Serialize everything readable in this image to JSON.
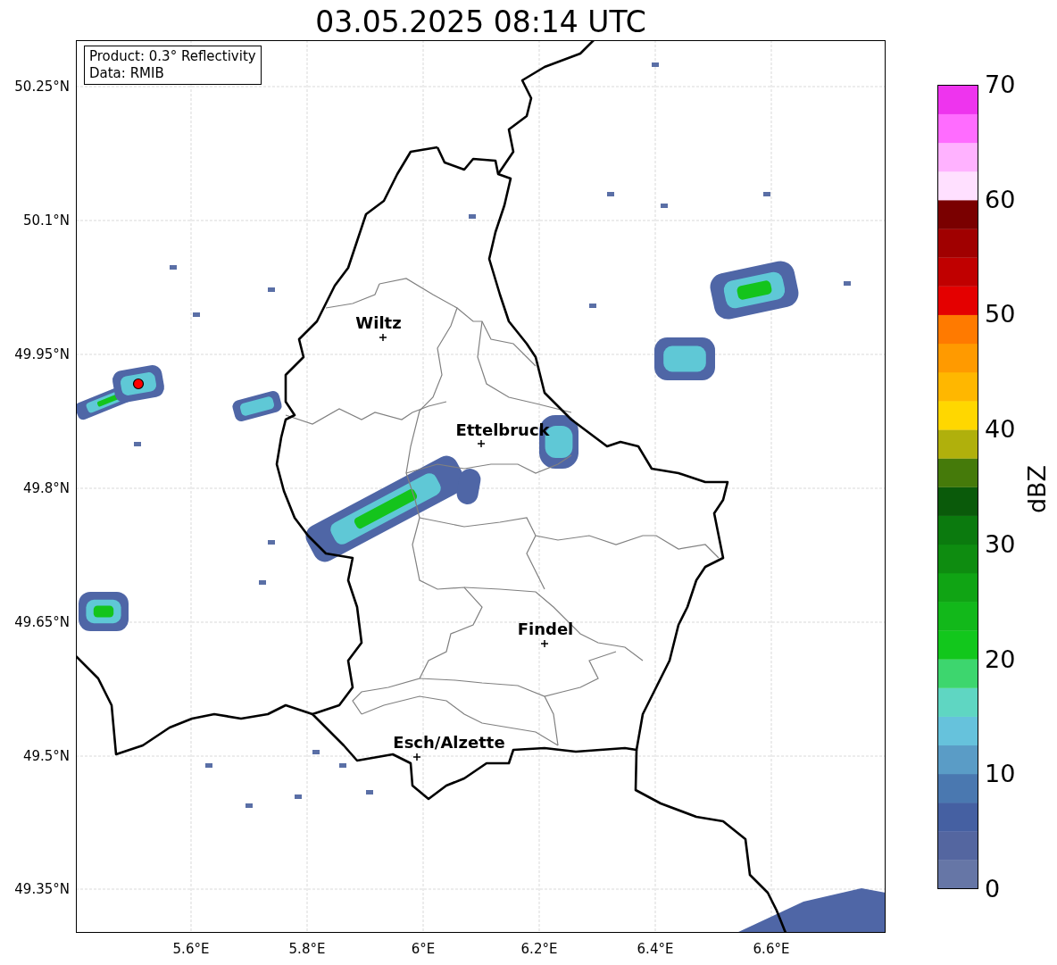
{
  "title": "03.05.2025 08:14 UTC",
  "map": {
    "info": [
      "Product: 0.3° Reflectivity",
      "Data: RMIB"
    ],
    "cities": [
      "Wiltz",
      "Ettelbruck",
      "Findel",
      "Esch/Alzette"
    ],
    "x_ticks": [
      "5.6°E",
      "5.8°E",
      "6°E",
      "6.2°E",
      "6.4°E",
      "6.6°E"
    ],
    "y_ticks": [
      "50.25°N",
      "50.1°N",
      "49.95°N",
      "49.8°N",
      "49.65°N",
      "49.5°N",
      "49.35°N"
    ]
  },
  "colorbar": {
    "label": "dBZ",
    "ticks": [
      "70",
      "60",
      "50",
      "40",
      "30",
      "20",
      "10",
      "0"
    ]
  }
}
